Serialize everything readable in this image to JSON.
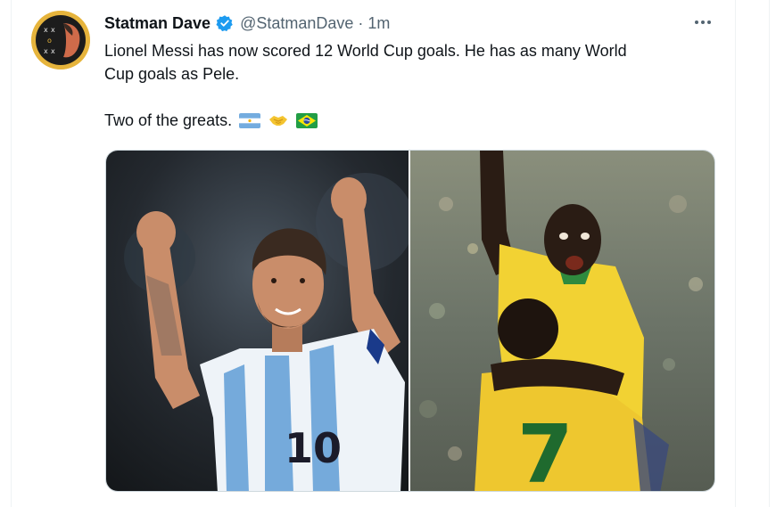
{
  "tweet": {
    "display_name": "Statman Dave",
    "handle": "@StatmanDave",
    "separator": "·",
    "time": "1m",
    "text_line1": "Lionel Messi has now scored 12 World Cup goals. He has as many World",
    "text_line2": "Cup goals as Pele.",
    "text_line3": "Two of the greats.",
    "emojis": [
      "flag-argentina-icon",
      "handshake-icon",
      "flag-brazil-icon"
    ]
  },
  "icons": {
    "verified": "verified-badge-icon",
    "more": "more-options-icon"
  },
  "colors": {
    "verified_blue": "#1d9bf0",
    "secondary_text": "#536471",
    "primary_text": "#0f1419",
    "border": "#cfd9de"
  },
  "media": {
    "count": 2,
    "images": [
      "messi-celebrating-photo",
      "pele-celebrating-photo"
    ],
    "visible_numbers": [
      "10",
      "7"
    ]
  }
}
